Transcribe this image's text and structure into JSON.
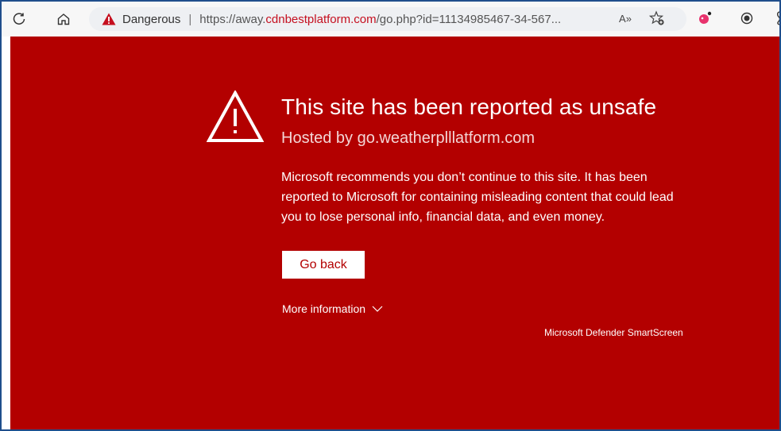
{
  "browser": {
    "refresh_icon": "refresh-icon",
    "home_icon": "home-icon",
    "address": {
      "status": "Dangerous",
      "separator": "|",
      "url_prefix": "https://away.",
      "url_domain": "cdnbestplatform.com",
      "url_path": "/go.php?id=11134985467-34-567...",
      "read_aloud_glyph": "A»"
    }
  },
  "page": {
    "title": "This site has been reported as unsafe",
    "hosted_by": "Hosted by go.weatherplllatform.com",
    "description": "Microsoft recommends you don’t continue to this site. It has been reported to Microsoft for containing misleading content that could lead you to lose personal info, financial data, and even money.",
    "go_back_label": "Go back",
    "more_info_label": "More information",
    "brand": "Microsoft Defender SmartScreen"
  },
  "colors": {
    "danger_background": "#b30000",
    "danger_text": "#c50f1f",
    "accent_white": "#ffffff"
  }
}
